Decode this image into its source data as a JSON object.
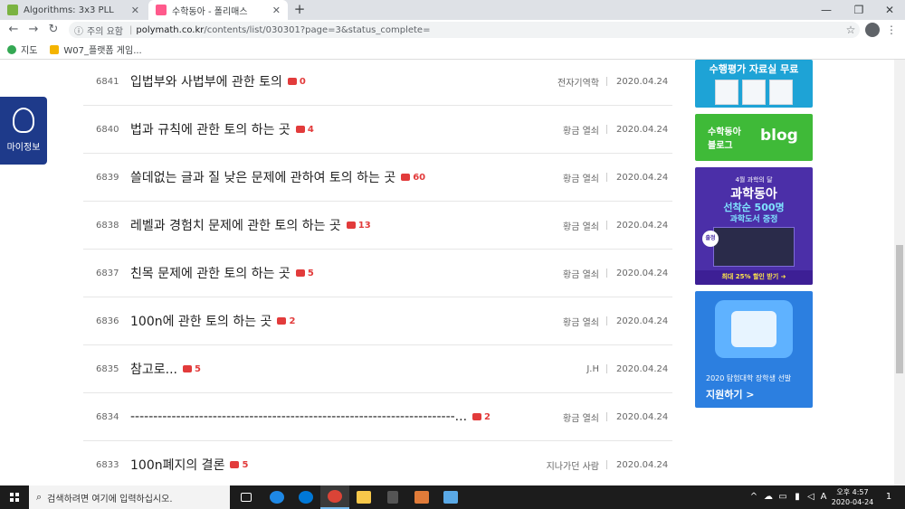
{
  "browser": {
    "tabs": [
      {
        "title": "Algorithms: 3x3 PLL",
        "active": false
      },
      {
        "title": "수학동아 - 폴리매스",
        "active": true
      }
    ],
    "new_tab": "+",
    "address": {
      "security_label": "주의 요함",
      "host": "polymath.co.kr",
      "path": "/contents/list/030301?page=3&status_complete="
    },
    "bookmarks": [
      "지도",
      "W07_플랫폼 게임..."
    ],
    "window_controls": [
      "—",
      "❐",
      "✕"
    ]
  },
  "sidebar_left": {
    "my_info_label": "마이정보"
  },
  "posts": [
    {
      "num": "6841",
      "title": "입법부와 사법부에 관한 토의",
      "comments": "0",
      "author": "전자기역학",
      "date": "2020.04.24"
    },
    {
      "num": "6840",
      "title": "법과 규칙에 관한 토의 하는 곳",
      "comments": "4",
      "author": "황금 열쇠",
      "date": "2020.04.24"
    },
    {
      "num": "6839",
      "title": "쓸데없는 글과 질 낮은 문제에 관하여 토의 하는 곳",
      "comments": "60",
      "author": "황금 열쇠",
      "date": "2020.04.24"
    },
    {
      "num": "6838",
      "title": "레벨과 경험치 문제에 관한 토의 하는 곳",
      "comments": "13",
      "author": "황금 열쇠",
      "date": "2020.04.24"
    },
    {
      "num": "6837",
      "title": "친목 문제에 관한 토의 하는 곳",
      "comments": "5",
      "author": "황금 열쇠",
      "date": "2020.04.24"
    },
    {
      "num": "6836",
      "title": "100n에 관한 토의 하는 곳",
      "comments": "2",
      "author": "황금 열쇠",
      "date": "2020.04.24"
    },
    {
      "num": "6835",
      "title": "참고로...",
      "comments": "5",
      "author": "J.H",
      "date": "2020.04.24"
    },
    {
      "num": "6834",
      "title": "-----------------------------------------------------------------------...",
      "comments": "2",
      "author": "황금 열쇠",
      "date": "2020.04.24"
    },
    {
      "num": "6833",
      "title": "100n폐지의 결론",
      "comments": "5",
      "author": "지나가던 사람",
      "date": "2020.04.24"
    }
  ],
  "banners": {
    "b1": {
      "title": "수행평가 자료실 무료"
    },
    "b2": {
      "line1": "수학동아",
      "line2": "블로그",
      "logo": "blog"
    },
    "b3": {
      "line1": "4월 과학의 달",
      "line2": "과학동아",
      "line3": "선착순 500명",
      "line4": "과학도서 증정",
      "badge": "출정",
      "line5": "최대 25% 할인 받기 ➜"
    },
    "b4": {
      "line1": "2020 탐험대학 장학생 선발",
      "line2": "지원하기 >"
    }
  },
  "taskbar": {
    "search_placeholder": "검색하려면 여기에 입력하십시오.",
    "tray": {
      "caret": "^",
      "ime": "A",
      "time": "오후 4:57",
      "date": "2020-04-24",
      "notif": "1"
    }
  }
}
